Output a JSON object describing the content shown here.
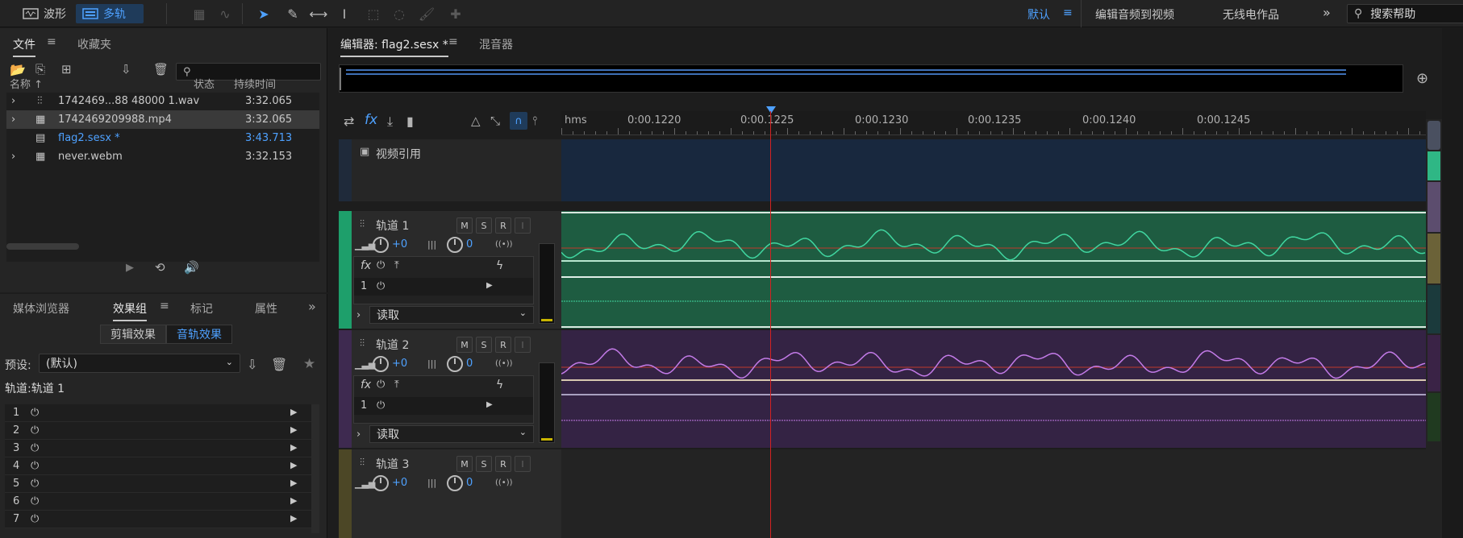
{
  "toolbar": {
    "waveform_label": "波形",
    "multitrack_label": "多轨",
    "workspaces": [
      "默认",
      "编辑音频到视频",
      "无线电作品"
    ],
    "help_placeholder": "搜索帮助"
  },
  "files_panel": {
    "tabs": [
      "文件",
      "收藏夹"
    ],
    "columns": {
      "name": "名称 ↑",
      "status": "状态",
      "duration": "持续时间"
    },
    "files": [
      {
        "name": "1742469...88 48000 1.wav",
        "duration": "3:32.065"
      },
      {
        "name": "1742469209988.mp4",
        "duration": "3:32.065"
      },
      {
        "name": "flag2.sesx *",
        "duration": "3:43.713"
      },
      {
        "name": "never.webm",
        "duration": "3:32.153"
      }
    ]
  },
  "effects_panel": {
    "tabs": [
      "媒体浏览器",
      "效果组",
      "标记",
      "属性"
    ],
    "segments": [
      "剪辑效果",
      "音轨效果"
    ],
    "preset_label": "预设:",
    "preset_value": "(默认)",
    "track_label": "轨道:轨道 1",
    "slots": [
      "1",
      "2",
      "3",
      "4",
      "5",
      "6",
      "7"
    ]
  },
  "editor": {
    "tabs": [
      "编辑器: flag2.sesx *",
      "混音器"
    ],
    "ruler": {
      "unit": "hms",
      "labels": [
        "0:00.1220",
        "0:00.1225",
        "0:00.1230",
        "0:00.1235",
        "0:00.1240",
        "0:00.1245"
      ]
    },
    "video_track": "视频引用",
    "tracks": [
      {
        "name": "轨道 1",
        "volume": "+0",
        "pan": "0",
        "read_mode": "读取",
        "slot1": "1",
        "color": "#1e5c41",
        "wave_color": "#40d6a0"
      },
      {
        "name": "轨道 2",
        "volume": "+0",
        "pan": "0",
        "read_mode": "读取",
        "slot1": "1",
        "color": "#342344",
        "wave_color": "#c37be8"
      },
      {
        "name": "轨道 3",
        "volume": "+0",
        "pan": "0",
        "color": "#2a2a2a"
      }
    ],
    "buttons": {
      "mute": "M",
      "solo": "S",
      "record": "R",
      "input": "I"
    }
  }
}
